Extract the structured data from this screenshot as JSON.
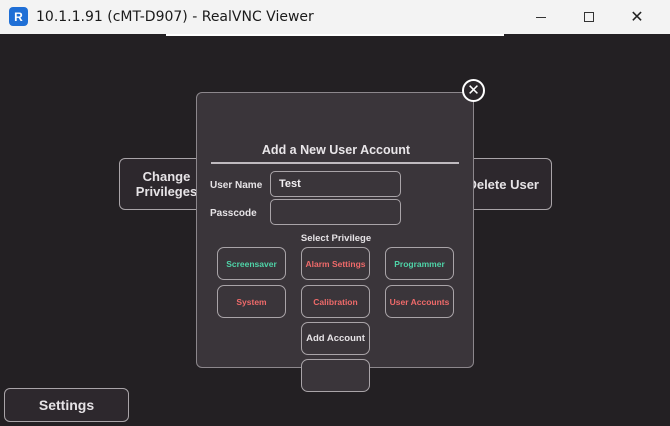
{
  "window": {
    "title": "10.1.1.91 (cMT-D907) - RealVNC Viewer",
    "app_icon": "realvnc-icon",
    "app_icon_text": "R"
  },
  "screen": {
    "change_privileges": "Change\nPrivileges",
    "delete_user": "Delete User",
    "settings": "Settings"
  },
  "dialog": {
    "title": "Add a New User Account",
    "user_name_label": "User Name",
    "user_name_value": "Test",
    "passcode_label": "Passcode",
    "passcode_value": "",
    "select_privilege": "Select Privilege",
    "privileges": [
      {
        "label": "Screensaver",
        "color": "#4fd4a8"
      },
      {
        "label": "Alarm Settings",
        "color": "#ef6a6a"
      },
      {
        "label": "Programmer",
        "color": "#4fd4a8"
      },
      {
        "label": "System",
        "color": "#ef6a6a"
      },
      {
        "label": "Calibration",
        "color": "#ef6a6a"
      },
      {
        "label": "User Accounts",
        "color": "#ef6a6a"
      }
    ],
    "add_account": "Add Account",
    "empty_button": ""
  },
  "colors": {
    "screen_bg": "#232023",
    "dialog_bg": "#3a353a",
    "enabled_green": "#4fd4a8",
    "disabled_red": "#ef6a6a"
  }
}
